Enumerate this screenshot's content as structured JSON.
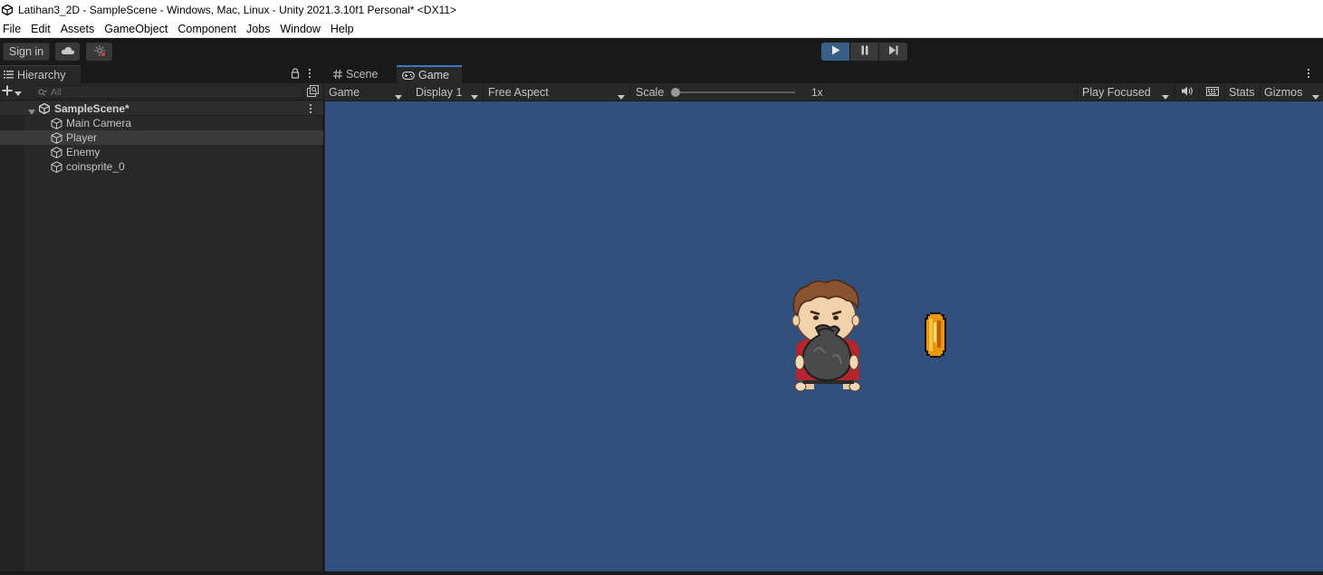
{
  "window": {
    "title": "Latihan3_2D - SampleScene - Windows, Mac, Linux - Unity 2021.3.10f1 Personal* <DX11>",
    "logo_icon": "unity-logo-icon"
  },
  "menubar": {
    "items": [
      "File",
      "Edit",
      "Assets",
      "GameObject",
      "Component",
      "Jobs",
      "Window",
      "Help"
    ]
  },
  "toolbar": {
    "sign_in_label": "Sign in",
    "cloud_icon": "cloud-icon",
    "collab_icon": "collab-icon",
    "play_icon": "play-icon",
    "pause_icon": "pause-icon",
    "step_icon": "step-icon",
    "play_active_color": "#3a5f87"
  },
  "hierarchy": {
    "tab_label": "Hierarchy",
    "search_placeholder": "All",
    "scene_name": "SampleScene*",
    "items": [
      {
        "label": "Main Camera"
      },
      {
        "label": "Player"
      },
      {
        "label": "Enemy"
      },
      {
        "label": "coinsprite_0"
      }
    ],
    "selected_index": 1
  },
  "gameview": {
    "tabs": {
      "scene": "Scene",
      "game": "Game"
    },
    "game_dropdown": "Game",
    "display_dropdown": "Display 1",
    "aspect_dropdown": "Free Aspect",
    "scale_label": "Scale",
    "scale_value": "1x",
    "play_mode_dropdown": "Play Focused",
    "stats_label": "Stats",
    "gizmos_label": "Gizmos",
    "background_color": "#31507e",
    "accent_color": "#3a79bb"
  }
}
